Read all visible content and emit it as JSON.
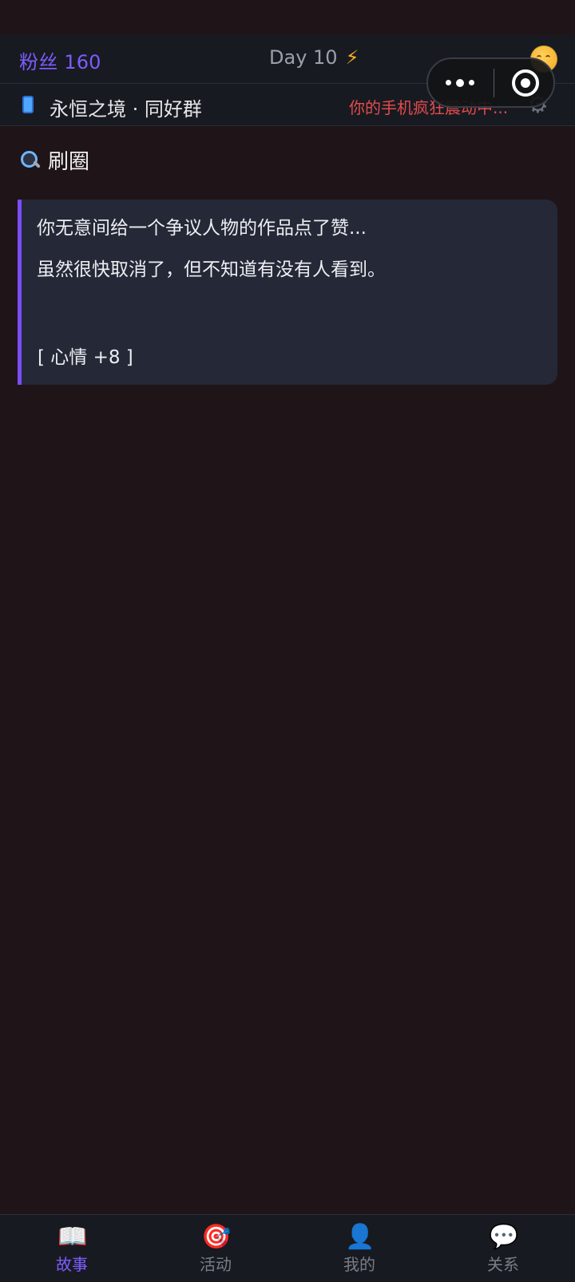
{
  "header": {
    "fans": "粉丝 160",
    "day": "Day 10",
    "bolt_icon": "lightning-icon",
    "mood_icon": "smiley-face-icon"
  },
  "capsule": {
    "menu_icon": "more-dots-icon",
    "target_icon": "target-ring-icon"
  },
  "group": {
    "icon": "phone-icon",
    "title": "永恒之境 · 同好群",
    "alert": "你的手机疯狂震动中...",
    "settings_icon": "gear-icon"
  },
  "section": {
    "icon": "search-icon",
    "title": "刷圈"
  },
  "story": {
    "lines": [
      "你无意间给一个争议人物的作品点了赞...",
      "虽然很快取消了，但不知道有没有人看到。"
    ],
    "effect": "[ 心情 +8 ]"
  },
  "tabs": [
    {
      "label": "故事",
      "icon": "book-icon",
      "active": true
    },
    {
      "label": "活动",
      "icon": "dartboard-icon",
      "active": false
    },
    {
      "label": "我的",
      "icon": "person-icon",
      "active": false
    },
    {
      "label": "关系",
      "icon": "chat-bubble-icon",
      "active": false
    }
  ],
  "colors": {
    "background": "#1f1418",
    "bar": "#181a21",
    "accent": "#7c5cff",
    "alert": "#e34b4b",
    "card": "#252836"
  }
}
